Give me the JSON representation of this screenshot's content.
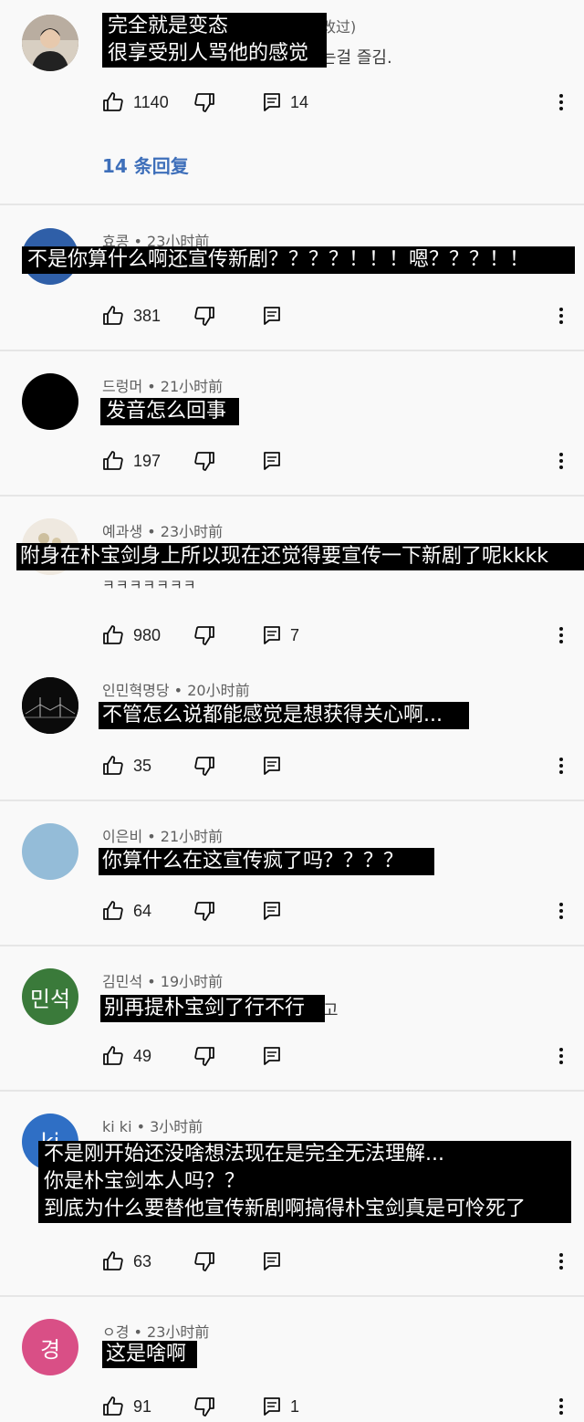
{
  "comments": [
    {
      "meta": "",
      "meta_trail": "改过)",
      "original_text": "는걸 즐김.",
      "original_tail": "",
      "subtitle": [
        "完全就是变态",
        "很享受别人骂他的感觉"
      ],
      "likes": "1140",
      "replies_count": "14",
      "replies_link": "14 条回复",
      "avatar_text": ""
    },
    {
      "meta": "효콩 • 23小时前",
      "subtitle": [
        "不是你算什么啊还宣传新剧？？？？！！！嗯？？？！！"
      ],
      "likes": "381",
      "avatar_text": ""
    },
    {
      "meta": "드렁머 • 21小时前",
      "subtitle": [
        "发音怎么回事"
      ],
      "likes": "197",
      "avatar_text": ""
    },
    {
      "meta": "예과생 • 23小时前",
      "subtitle": [
        "附身在朴宝剑身上所以现在还觉得要宣传一下新剧了呢kkkk"
      ],
      "original_text": "ㅋㅋㅋㅋㅋㅋㅋ",
      "likes": "980",
      "replies_count": "7",
      "avatar_text": ""
    },
    {
      "meta": "인민혁명당 • 20小时前",
      "subtitle": [
        "不管怎么说都能感觉是想获得关心啊..."
      ],
      "likes": "35",
      "avatar_text": ""
    },
    {
      "meta": "이은비 • 21小时前",
      "subtitle": [
        "你算什么在这宣传疯了吗？？？？"
      ],
      "likes": "64",
      "avatar_text": ""
    },
    {
      "meta": "김민석 • 19小时前",
      "subtitle": [
        "别再提朴宝剑了行不行"
      ],
      "original_tail": "고",
      "likes": "49",
      "avatar_text": "민석"
    },
    {
      "meta": "ki ki • 3小时前",
      "subtitle": [
        "不是刚开始还没啥想法现在是完全无法理解...",
        "你是朴宝剑本人吗？？",
        "到底为什么要替他宣传新剧啊搞得朴宝剑真是可怜死了"
      ],
      "likes": "63",
      "avatar_text": "ki"
    },
    {
      "meta": "ㅇ경 • 23小时前",
      "subtitle": [
        "这是啥啊"
      ],
      "likes": "91",
      "replies_count": "1",
      "avatar_text": "경"
    }
  ],
  "colors": {
    "background": "#f9f9f9",
    "reply_link": "#3e6fba",
    "avatar_1": "#6b5a4a",
    "avatar_2": "#2f5fa8",
    "avatar_3": "#000000",
    "avatar_4": "#ece6dc",
    "avatar_5": "#0d0d0d",
    "avatar_6": "#94bcd8",
    "avatar_7": "#3a7a3a",
    "avatar_8": "#2f6fc5",
    "avatar_9": "#d94f86"
  },
  "icons": {
    "like": "thumb-up-icon",
    "dislike": "thumb-down-icon",
    "reply": "comment-icon",
    "more": "more-vertical-icon"
  }
}
